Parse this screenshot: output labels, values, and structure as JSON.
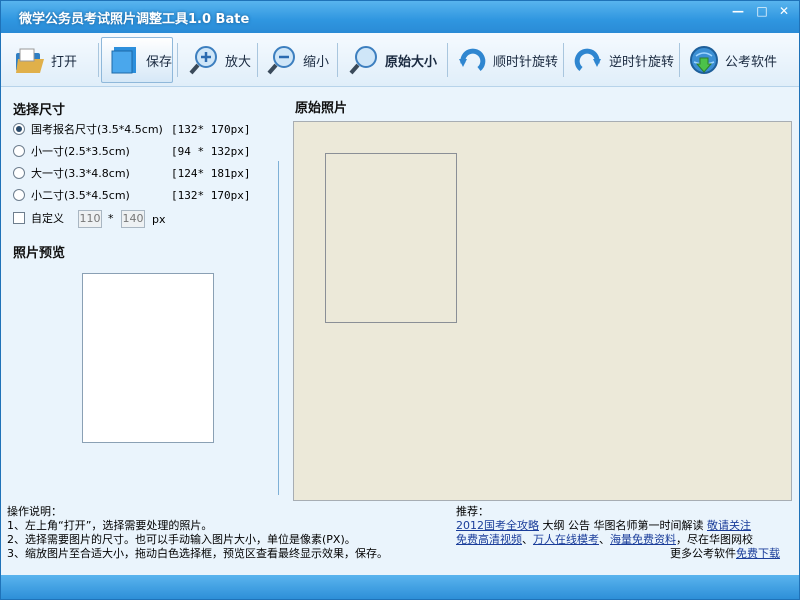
{
  "window": {
    "title": "微学公务员考试照片调整工具1.0 Bate",
    "min": "—",
    "max": "□",
    "close": "✕"
  },
  "toolbar": {
    "open": "打开",
    "save": "保存",
    "zoom_in": "放大",
    "zoom_out": "缩小",
    "original_size": "原始大小",
    "rotate_cw": "顺时针旋转",
    "rotate_ccw": "逆时针旋转",
    "software": "公考软件"
  },
  "size_panel": {
    "title": "选择尺寸",
    "options": [
      {
        "label": "国考报名尺寸(3.5*4.5cm)",
        "size": "[132* 170px]",
        "selected": true
      },
      {
        "label": "小一寸(2.5*3.5cm)",
        "size": "[94 * 132px]",
        "selected": false
      },
      {
        "label": "大一寸(3.3*4.8cm)",
        "size": "[124* 181px]",
        "selected": false
      },
      {
        "label": "小二寸(3.5*4.5cm)",
        "size": "[132* 170px]",
        "selected": false
      }
    ],
    "custom": {
      "label": "自定义",
      "width": "110",
      "times": "*",
      "height": "140",
      "unit": "px"
    }
  },
  "preview": {
    "title": "照片预览"
  },
  "original": {
    "title": "原始照片"
  },
  "help": {
    "title": "操作说明：",
    "lines": [
      "1、左上角“打开”，选择需要处理的照片。",
      "2、选择需要图片的尺寸。也可以手动输入图片大小，单位是像素(PX)。",
      "3、缩放图片至合适大小，拖动白色选择框，预览区查看最终显示效果，保存。"
    ]
  },
  "recommend": {
    "title": "推荐：",
    "l1_link": "2012国考全攻略",
    "l1_text": " 大纲 公告 华图名师第一时间解读 ",
    "l1_link2": "敬请关注",
    "l2_link1": "免费高清视频",
    "l2_sep1": "、",
    "l2_link2": "万人在线模考",
    "l2_sep2": "、",
    "l2_link3": "海量免费资料",
    "l2_text": "，尽在华图网校",
    "l3_text": "更多公考软件",
    "l3_link": "免费下载"
  }
}
